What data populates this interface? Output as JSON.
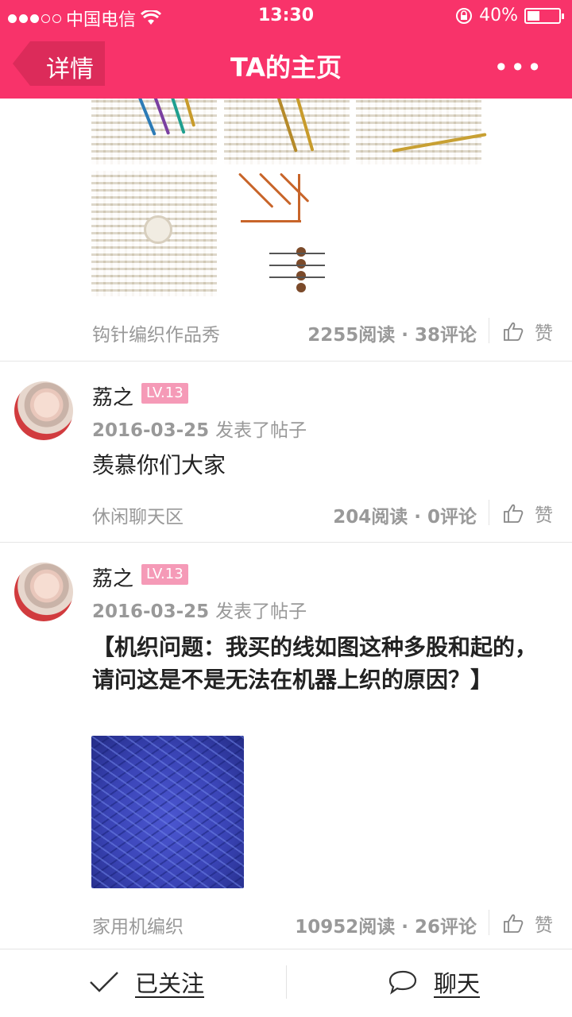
{
  "status_bar": {
    "carrier": "中国电信",
    "time": "13:30",
    "battery": "40%",
    "battery_level": 0.4,
    "signal_dots": 5,
    "signal_filled": 3
  },
  "nav": {
    "back_label": "详情",
    "title": "TA的主页",
    "more_label": "•••"
  },
  "posts": [
    {
      "category": "钩针编织作品秀",
      "stats": "2255阅读 · 38评论",
      "like_label": "赞"
    },
    {
      "author": "荔之",
      "level": "LV.13",
      "date": "2016-03-25",
      "action": "发表了帖子",
      "text": "羡慕你们大家",
      "category": "休闲聊天区",
      "stats": "204阅读 · 0评论",
      "like_label": "赞"
    },
    {
      "author": "荔之",
      "level": "LV.13",
      "date": "2016-03-25",
      "action": "发表了帖子",
      "text": "【机织问题：我买的线如图这种多股和起的，请问这是不是无法在机器上织的原因？】",
      "category": "家用机编织",
      "stats": "10952阅读 · 26评论",
      "like_label": "赞"
    }
  ],
  "bottom_bar": {
    "follow_label": "已关注",
    "chat_label": "聊天"
  },
  "colors": {
    "brand": "#f8336a",
    "level_badge": "#f59ab7",
    "muted_text": "#999999",
    "yarn_blue": "#3a44b6"
  }
}
